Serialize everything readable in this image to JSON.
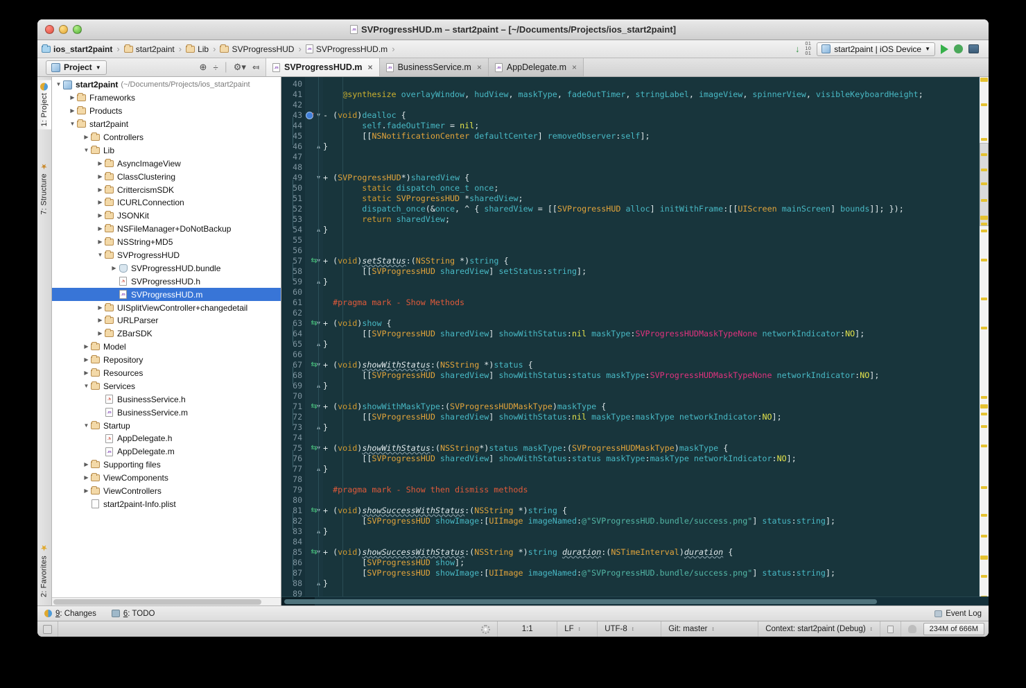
{
  "window": {
    "title": "SVProgressHUD.m – start2paint – [~/Documents/Projects/ios_start2paint]",
    "title_icon": "objc-m-file-icon"
  },
  "breadcrumb": {
    "items": [
      {
        "label": "ios_start2paint",
        "icon": "folder-blue-icon"
      },
      {
        "label": "start2paint",
        "icon": "folder-icon"
      },
      {
        "label": "Lib",
        "icon": "folder-icon"
      },
      {
        "label": "SVProgressHUD",
        "icon": "folder-icon"
      },
      {
        "label": "SVProgressHUD.m",
        "icon": "objc-m-file-icon"
      }
    ],
    "separator": "›",
    "run_config": "start2paint | iOS Device",
    "download_icon": "update-project-icon",
    "run_icon": "run-icon",
    "debug_icon": "debug-icon",
    "screenshot_icon": "device-screenshot-icon"
  },
  "toolbar": {
    "project_chip": "Project",
    "chip_caret": "▾",
    "icons": [
      "locate-icon",
      "collapse-all-icon",
      "settings-gear-icon",
      "hide-icon"
    ]
  },
  "editor_tabs": [
    {
      "label": "SVProgressHUD.m",
      "icon": "objc-m-file-icon",
      "close": "×",
      "active": true
    },
    {
      "label": "BusinessService.m",
      "icon": "objc-m-file-icon",
      "close": "×",
      "active": false
    },
    {
      "label": "AppDelegate.m",
      "icon": "objc-m-file-icon",
      "close": "×",
      "active": false
    }
  ],
  "left_tool_tabs": [
    {
      "label": "1: Project",
      "icon": "project-icon",
      "selected": true
    },
    {
      "label": "7: Structure",
      "icon": "structure-icon",
      "selected": false
    },
    {
      "label": "2: Favorites",
      "icon": "favorites-star-icon",
      "selected": false
    }
  ],
  "tree": [
    {
      "depth": 0,
      "arrow": "down",
      "icon": "project-icon",
      "label": "start2paint",
      "bold": true,
      "sub": "(~/Documents/Projects/ios_start2paint",
      "selected": false
    },
    {
      "depth": 1,
      "arrow": "right",
      "icon": "folder-icon",
      "label": "Frameworks",
      "selected": false
    },
    {
      "depth": 1,
      "arrow": "right",
      "icon": "folder-icon",
      "label": "Products",
      "selected": false
    },
    {
      "depth": 1,
      "arrow": "down",
      "icon": "folder-icon",
      "label": "start2paint",
      "selected": false
    },
    {
      "depth": 2,
      "arrow": "right",
      "icon": "folder-icon",
      "label": "Controllers",
      "selected": false
    },
    {
      "depth": 2,
      "arrow": "down",
      "icon": "folder-icon",
      "label": "Lib",
      "selected": false
    },
    {
      "depth": 3,
      "arrow": "right",
      "icon": "folder-icon",
      "label": "AsyncImageView",
      "selected": false
    },
    {
      "depth": 3,
      "arrow": "right",
      "icon": "folder-icon",
      "label": "ClassClustering",
      "selected": false
    },
    {
      "depth": 3,
      "arrow": "right",
      "icon": "folder-icon",
      "label": "CrittercismSDK",
      "selected": false
    },
    {
      "depth": 3,
      "arrow": "right",
      "icon": "folder-icon",
      "label": "ICURLConnection",
      "selected": false
    },
    {
      "depth": 3,
      "arrow": "right",
      "icon": "folder-icon",
      "label": "JSONKit",
      "selected": false
    },
    {
      "depth": 3,
      "arrow": "right",
      "icon": "folder-icon",
      "label": "NSFileManager+DoNotBackup",
      "selected": false
    },
    {
      "depth": 3,
      "arrow": "right",
      "icon": "folder-icon",
      "label": "NSString+MD5",
      "selected": false
    },
    {
      "depth": 3,
      "arrow": "down",
      "icon": "folder-icon",
      "label": "SVProgressHUD",
      "selected": false
    },
    {
      "depth": 4,
      "arrow": "right",
      "icon": "bundle-icon",
      "label": "SVProgressHUD.bundle",
      "selected": false
    },
    {
      "depth": 4,
      "arrow": "none",
      "icon": "objc-h-file-icon",
      "label": "SVProgressHUD.h",
      "selected": false
    },
    {
      "depth": 4,
      "arrow": "none",
      "icon": "objc-m-file-icon",
      "label": "SVProgressHUD.m",
      "selected": true
    },
    {
      "depth": 3,
      "arrow": "right",
      "icon": "folder-icon",
      "label": "UISplitViewController+changedetail",
      "selected": false
    },
    {
      "depth": 3,
      "arrow": "right",
      "icon": "folder-icon",
      "label": "URLParser",
      "selected": false
    },
    {
      "depth": 3,
      "arrow": "right",
      "icon": "folder-icon",
      "label": "ZBarSDK",
      "selected": false
    },
    {
      "depth": 2,
      "arrow": "right",
      "icon": "folder-icon",
      "label": "Model",
      "selected": false
    },
    {
      "depth": 2,
      "arrow": "right",
      "icon": "folder-icon",
      "label": "Repository",
      "selected": false
    },
    {
      "depth": 2,
      "arrow": "right",
      "icon": "folder-icon",
      "label": "Resources",
      "selected": false
    },
    {
      "depth": 2,
      "arrow": "down",
      "icon": "folder-icon",
      "label": "Services",
      "selected": false
    },
    {
      "depth": 3,
      "arrow": "none",
      "icon": "objc-h-file-icon",
      "label": "BusinessService.h",
      "selected": false
    },
    {
      "depth": 3,
      "arrow": "none",
      "icon": "objc-m-file-icon",
      "label": "BusinessService.m",
      "selected": false
    },
    {
      "depth": 2,
      "arrow": "down",
      "icon": "folder-icon",
      "label": "Startup",
      "selected": false
    },
    {
      "depth": 3,
      "arrow": "none",
      "icon": "objc-h-file-icon",
      "label": "AppDelegate.h",
      "selected": false
    },
    {
      "depth": 3,
      "arrow": "none",
      "icon": "objc-m-file-icon",
      "label": "AppDelegate.m",
      "selected": false
    },
    {
      "depth": 2,
      "arrow": "right",
      "icon": "folder-icon",
      "label": "Supporting files",
      "selected": false
    },
    {
      "depth": 2,
      "arrow": "right",
      "icon": "folder-icon",
      "label": "ViewComponents",
      "selected": false
    },
    {
      "depth": 2,
      "arrow": "right",
      "icon": "folder-icon",
      "label": "ViewControllers",
      "selected": false
    },
    {
      "depth": 2,
      "arrow": "none",
      "icon": "plist-file-icon",
      "label": "start2paint-Info.plist",
      "selected": false
    }
  ],
  "code": {
    "first_line": 40,
    "lines": [
      {
        "n": 40,
        "fold": "",
        "mark": "",
        "text": ""
      },
      {
        "n": 41,
        "fold": "",
        "mark": "",
        "text": "    @synthesize overlayWindow, hudView, maskType, fadeOutTimer, stringLabel, imageView, spinnerView, visibleKeyboardHeight;"
      },
      {
        "n": 42,
        "fold": "",
        "mark": "",
        "text": ""
      },
      {
        "n": 43,
        "fold": "open",
        "mark": "breakpoint",
        "text": "- (void)dealloc {"
      },
      {
        "n": 44,
        "fold": "",
        "mark": "",
        "text": "        self.fadeOutTimer = nil;"
      },
      {
        "n": 45,
        "fold": "",
        "mark": "",
        "text": "        [[NSNotificationCenter defaultCenter] removeObserver:self];"
      },
      {
        "n": 46,
        "fold": "close",
        "mark": "",
        "text": "}"
      },
      {
        "n": 47,
        "fold": "",
        "mark": "",
        "text": ""
      },
      {
        "n": 48,
        "fold": "",
        "mark": "",
        "text": ""
      },
      {
        "n": 49,
        "fold": "open",
        "mark": "",
        "text": "+ (SVProgressHUD*)sharedView {"
      },
      {
        "n": 50,
        "fold": "",
        "mark": "",
        "text": "        static dispatch_once_t once;"
      },
      {
        "n": 51,
        "fold": "",
        "mark": "",
        "text": "        static SVProgressHUD *sharedView;"
      },
      {
        "n": 52,
        "fold": "",
        "mark": "",
        "text": "        dispatch_once(&once, ^ { sharedView = [[SVProgressHUD alloc] initWithFrame:[[UIScreen mainScreen] bounds]]; });"
      },
      {
        "n": 53,
        "fold": "",
        "mark": "",
        "text": "        return sharedView;"
      },
      {
        "n": 54,
        "fold": "close",
        "mark": "",
        "text": "}"
      },
      {
        "n": 55,
        "fold": "",
        "mark": "",
        "text": ""
      },
      {
        "n": 56,
        "fold": "",
        "mark": "",
        "text": ""
      },
      {
        "n": 57,
        "fold": "open",
        "mark": "override",
        "text": "+ (void)setStatus:(NSString *)string {"
      },
      {
        "n": 58,
        "fold": "",
        "mark": "",
        "text": "        [[SVProgressHUD sharedView] setStatus:string];"
      },
      {
        "n": 59,
        "fold": "close",
        "mark": "",
        "text": "}"
      },
      {
        "n": 60,
        "fold": "",
        "mark": "",
        "text": ""
      },
      {
        "n": 61,
        "fold": "",
        "mark": "",
        "text": "  #pragma mark - Show Methods"
      },
      {
        "n": 62,
        "fold": "",
        "mark": "",
        "text": ""
      },
      {
        "n": 63,
        "fold": "open",
        "mark": "override",
        "text": "+ (void)show {"
      },
      {
        "n": 64,
        "fold": "",
        "mark": "",
        "text": "        [[SVProgressHUD sharedView] showWithStatus:nil maskType:SVProgressHUDMaskTypeNone networkIndicator:NO];"
      },
      {
        "n": 65,
        "fold": "close",
        "mark": "",
        "text": "}"
      },
      {
        "n": 66,
        "fold": "",
        "mark": "",
        "text": ""
      },
      {
        "n": 67,
        "fold": "open",
        "mark": "override",
        "text": "+ (void)showWithStatus:(NSString *)status {"
      },
      {
        "n": 68,
        "fold": "",
        "mark": "",
        "text": "        [[SVProgressHUD sharedView] showWithStatus:status maskType:SVProgressHUDMaskTypeNone networkIndicator:NO];"
      },
      {
        "n": 69,
        "fold": "close",
        "mark": "",
        "text": "}"
      },
      {
        "n": 70,
        "fold": "",
        "mark": "",
        "text": ""
      },
      {
        "n": 71,
        "fold": "open",
        "mark": "override",
        "text": "+ (void)showWithMaskType:(SVProgressHUDMaskType)maskType {"
      },
      {
        "n": 72,
        "fold": "",
        "mark": "",
        "text": "        [[SVProgressHUD sharedView] showWithStatus:nil maskType:maskType networkIndicator:NO];"
      },
      {
        "n": 73,
        "fold": "close",
        "mark": "",
        "text": "}"
      },
      {
        "n": 74,
        "fold": "",
        "mark": "",
        "text": ""
      },
      {
        "n": 75,
        "fold": "open",
        "mark": "override",
        "text": "+ (void)showWithStatus:(NSString*)status maskType:(SVProgressHUDMaskType)maskType {"
      },
      {
        "n": 76,
        "fold": "",
        "mark": "",
        "text": "        [[SVProgressHUD sharedView] showWithStatus:status maskType:maskType networkIndicator:NO];"
      },
      {
        "n": 77,
        "fold": "close",
        "mark": "",
        "text": "}"
      },
      {
        "n": 78,
        "fold": "",
        "mark": "",
        "text": ""
      },
      {
        "n": 79,
        "fold": "",
        "mark": "",
        "text": "  #pragma mark - Show then dismiss methods"
      },
      {
        "n": 80,
        "fold": "",
        "mark": "",
        "text": ""
      },
      {
        "n": 81,
        "fold": "open",
        "mark": "override",
        "text": "+ (void)showSuccessWithStatus:(NSString *)string {"
      },
      {
        "n": 82,
        "fold": "",
        "mark": "",
        "text": "        [SVProgressHUD showImage:[UIImage imageNamed:@\"SVProgressHUD.bundle/success.png\"] status:string];"
      },
      {
        "n": 83,
        "fold": "close",
        "mark": "",
        "text": "}"
      },
      {
        "n": 84,
        "fold": "",
        "mark": "",
        "text": ""
      },
      {
        "n": 85,
        "fold": "open",
        "mark": "override",
        "text": "+ (void)showSuccessWithStatus:(NSString *)string duration:(NSTimeInterval)duration {"
      },
      {
        "n": 86,
        "fold": "",
        "mark": "",
        "text": "        [SVProgressHUD show];"
      },
      {
        "n": 87,
        "fold": "",
        "mark": "",
        "text": "        [SVProgressHUD showImage:[UIImage imageNamed:@\"SVProgressHUD.bundle/success.png\"] status:string];"
      },
      {
        "n": 88,
        "fold": "close",
        "mark": "",
        "text": "}"
      },
      {
        "n": 89,
        "fold": "",
        "mark": "",
        "text": ""
      }
    ]
  },
  "bottom_bar": {
    "items": [
      {
        "label": "9: Changes",
        "num": "9",
        "rest": ": Changes",
        "icon": "changes-icon"
      },
      {
        "label": "6: TODO",
        "num": "6",
        "rest": ": TODO",
        "icon": "todo-icon"
      }
    ],
    "event_log": "Event Log",
    "event_log_icon": "event-log-icon"
  },
  "status_bar": {
    "caret_position": "1:1",
    "line_separator": "LF",
    "encoding": "UTF-8",
    "vcs_branch": "Git: master",
    "context": "Context: start2paint (Debug)",
    "memory": "234M of 666M",
    "caret_glyph": "↕",
    "lock_icon": "lock-icon",
    "hat_icon": "hector-icon",
    "spinner_icon": "background-tasks-icon"
  },
  "colors": {
    "editor_bg": "#18353c",
    "gutter_bg": "#16313a",
    "selection_blue": "#3875d7",
    "stripe_marker": "#e5c231",
    "accent_pink": "#e0337e",
    "accent_orange": "#e2a43b",
    "accent_cyan": "#48b8c4",
    "accent_green_string": "#53b7a6",
    "accent_pragma": "#e05a3a"
  },
  "stripe_markers_y": [
    1,
    38,
    88,
    110,
    132,
    152,
    176,
    200,
    210,
    220,
    262,
    318,
    360,
    460,
    472,
    484,
    502,
    530,
    590,
    630,
    660,
    690,
    718,
    748
  ]
}
